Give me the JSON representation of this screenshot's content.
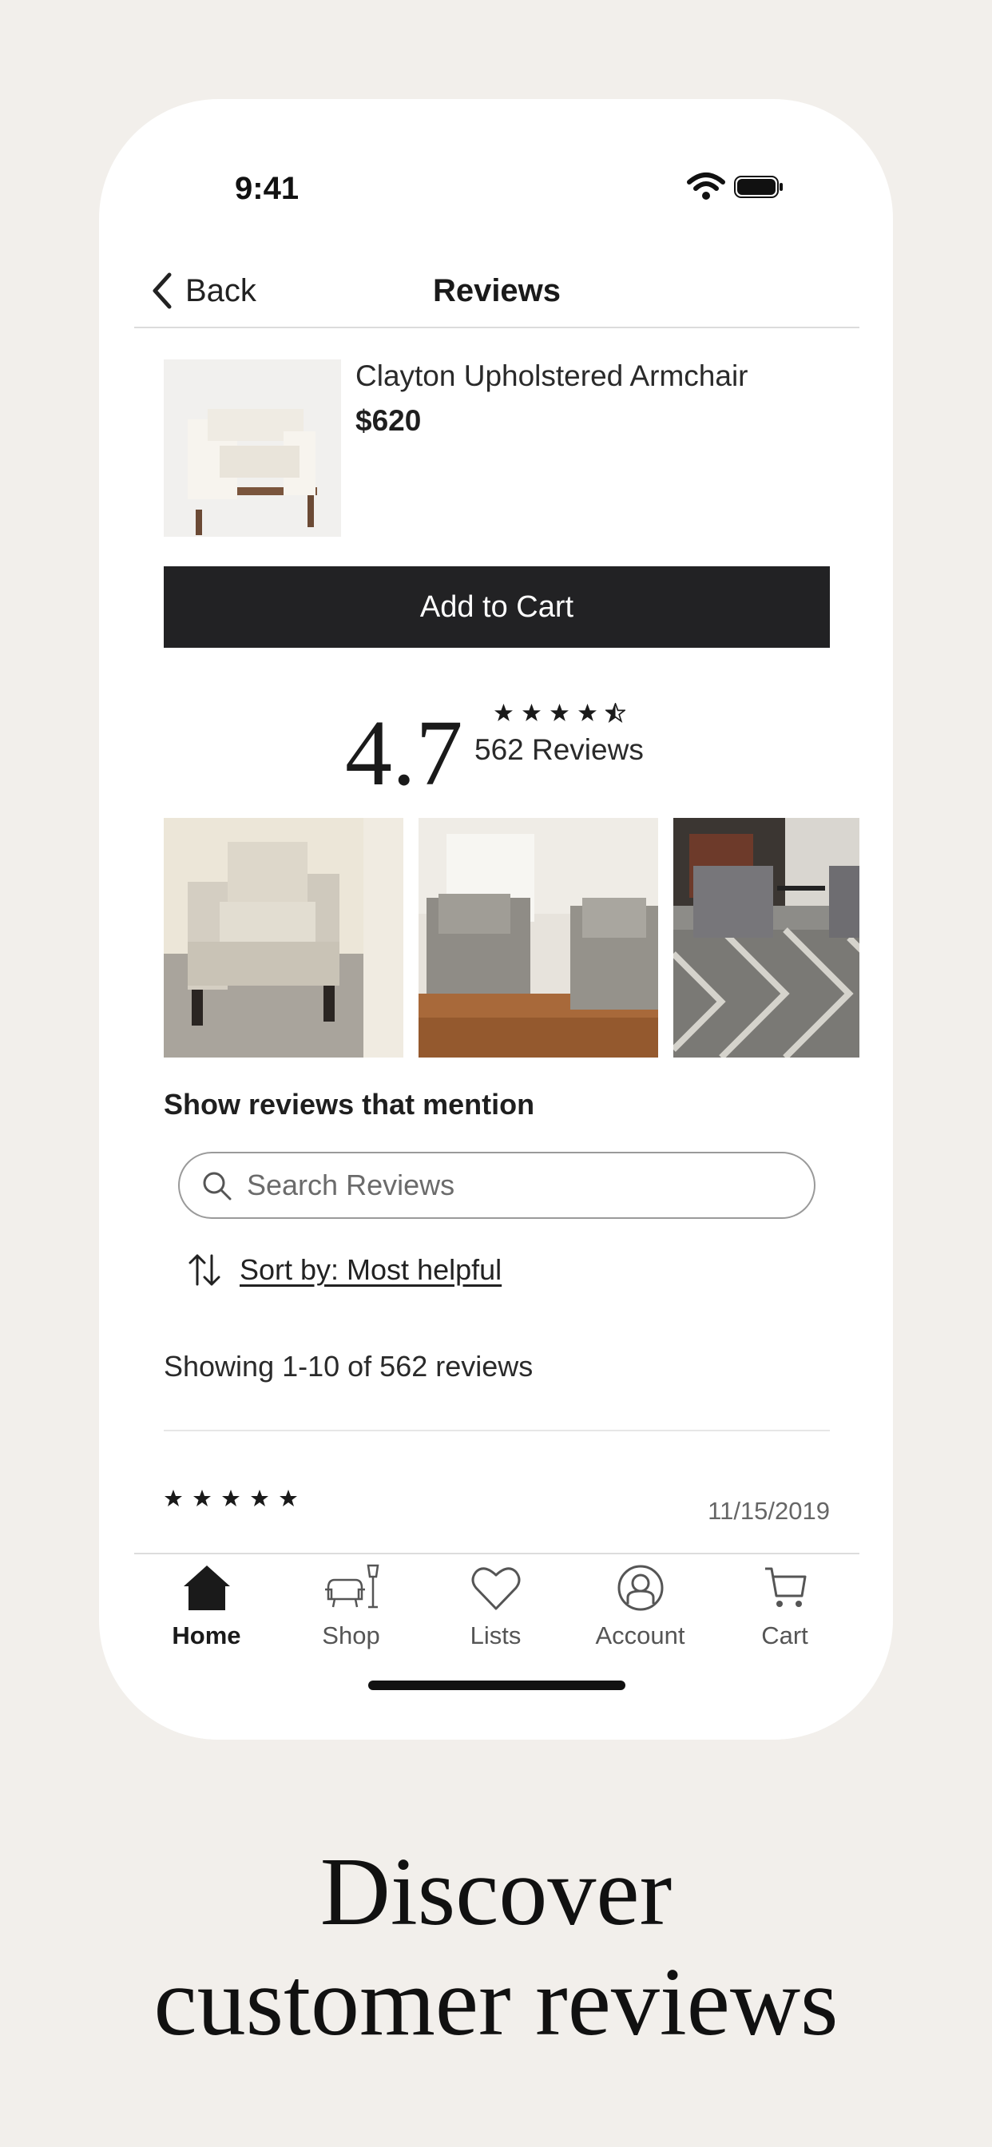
{
  "status_bar": {
    "time": "9:41"
  },
  "nav": {
    "back_label": "Back",
    "title": "Reviews"
  },
  "product": {
    "name": "Clayton Upholstered Armchair",
    "price": "$620"
  },
  "cart_button": {
    "label": "Add to Cart"
  },
  "rating": {
    "value": "4.7",
    "stars": 4.5,
    "count_label": "562 Reviews"
  },
  "gallery": {
    "photo_count_visible": 3
  },
  "mention": {
    "heading": "Show reviews that mention"
  },
  "search": {
    "placeholder": "Search Reviews"
  },
  "sort": {
    "label": "Sort by: Most helpful"
  },
  "results": {
    "showing": "Showing 1-10 of 562 reviews"
  },
  "first_review": {
    "stars": 5,
    "date": "11/15/2019"
  },
  "tabs": [
    {
      "label": "Home",
      "icon": "home-icon",
      "active": true
    },
    {
      "label": "Shop",
      "icon": "chair-lamp-icon",
      "active": false
    },
    {
      "label": "Lists",
      "icon": "heart-icon",
      "active": false
    },
    {
      "label": "Account",
      "icon": "account-icon",
      "active": false
    },
    {
      "label": "Cart",
      "icon": "cart-icon",
      "active": false
    }
  ],
  "headline": {
    "line1": "Discover",
    "line2": "customer reviews"
  },
  "colors": {
    "background": "#f2efeb",
    "button": "#222224",
    "text": "#1f1f1f"
  }
}
